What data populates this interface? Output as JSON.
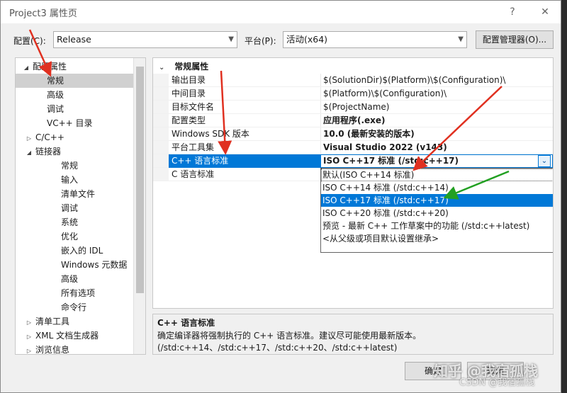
{
  "window": {
    "title": "Project3 属性页",
    "help_label": "?",
    "close_label": "✕"
  },
  "toolbar": {
    "config_label": "配置(C):",
    "config_value": "Release",
    "platform_label": "平台(P):",
    "platform_value": "活动(x64)",
    "config_manager_label": "配置管理器(O)..."
  },
  "tree": {
    "items": [
      {
        "label": "配置属性",
        "expander": "◢"
      },
      {
        "label": "常规",
        "expander": ""
      },
      {
        "label": "高级",
        "expander": ""
      },
      {
        "label": "调试",
        "expander": ""
      },
      {
        "label": "VC++ 目录",
        "expander": ""
      },
      {
        "label": "C/C++",
        "expander": "▷"
      },
      {
        "label": "链接器",
        "expander": "◢"
      },
      {
        "label": "常规",
        "expander": ""
      },
      {
        "label": "输入",
        "expander": ""
      },
      {
        "label": "清单文件",
        "expander": ""
      },
      {
        "label": "调试",
        "expander": ""
      },
      {
        "label": "系统",
        "expander": ""
      },
      {
        "label": "优化",
        "expander": ""
      },
      {
        "label": "嵌入的 IDL",
        "expander": ""
      },
      {
        "label": "Windows 元数据",
        "expander": ""
      },
      {
        "label": "高级",
        "expander": ""
      },
      {
        "label": "所有选项",
        "expander": ""
      },
      {
        "label": "命令行",
        "expander": ""
      },
      {
        "label": "清单工具",
        "expander": "▷"
      },
      {
        "label": "XML 文档生成器",
        "expander": "▷"
      },
      {
        "label": "浏览信息",
        "expander": "▷"
      }
    ]
  },
  "grid": {
    "category": "常规属性",
    "category_caret": "⌄",
    "rows": [
      {
        "name": "输出目录",
        "value": "$(SolutionDir)$(Platform)\\$(Configuration)\\"
      },
      {
        "name": "中间目录",
        "value": "$(Platform)\\$(Configuration)\\"
      },
      {
        "name": "目标文件名",
        "value": "$(ProjectName)"
      },
      {
        "name": "配置类型",
        "value": "应用程序(.exe)"
      },
      {
        "name": "Windows SDK 版本",
        "value": "10.0 (最新安装的版本)"
      },
      {
        "name": "平台工具集",
        "value": "Visual Studio 2022 (v143)"
      },
      {
        "name": "C++ 语言标准",
        "value": "ISO C++17 标准 (/std:c++17)"
      },
      {
        "name": "C 语言标准",
        "value": ""
      }
    ],
    "dropdown_arrow": "⌄",
    "dropdown_options": [
      "默认(ISO C++14 标准)",
      "ISO C++14 标准 (/std:c++14)",
      "ISO C++17 标准 (/std:c++17)",
      "ISO C++20 标准 (/std:c++20)",
      "预览 - 最新 C++ 工作草案中的功能 (/std:c++latest)",
      "<从父级或项目默认设置继承>"
    ]
  },
  "description": {
    "title": "C++ 语言标准",
    "text": "确定编译器将强制执行的 C++ 语言标准。建议尽可能使用最新版本。(/std:c++14、/std:c++17、/std:c++20、/std:c++latest)"
  },
  "footer": {
    "ok_label": "确定",
    "cancel_label": "取消"
  },
  "watermark": {
    "line1": "知乎 @我宿孤栈",
    "line2": "CSDN @我宿孤栈"
  },
  "colors": {
    "selection": "#0078d7",
    "arrow_red": "#e03020",
    "arrow_green": "#22a022"
  }
}
